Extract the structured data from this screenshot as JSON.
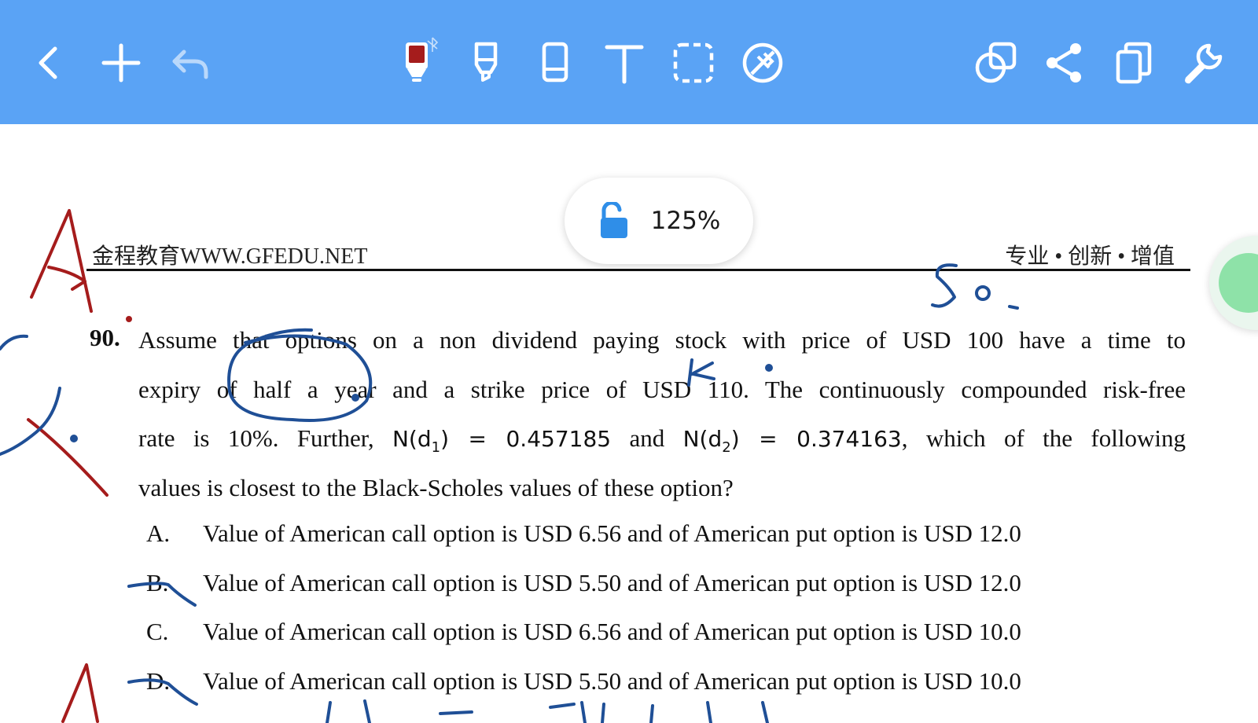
{
  "toolbar": {
    "left_icons": [
      "back-icon",
      "add-icon",
      "undo-icon"
    ],
    "center_icons": [
      "pen-icon",
      "highlighter-icon",
      "eraser-icon",
      "text-icon",
      "lasso-select-icon",
      "clear-icon"
    ],
    "right_icons": [
      "shapes-icon",
      "share-icon",
      "pages-icon",
      "settings-wrench-icon"
    ],
    "colors": {
      "bar": "#5aa3f5",
      "pen_ink": "#a51c1c",
      "icon": "#ffffff"
    }
  },
  "zoom": {
    "level": "125%",
    "lock_color": "#2f8ee8"
  },
  "document": {
    "header_left": "金程教育WWW.GFEDU.NET",
    "header_right": "专业 • 创新 • 增值",
    "question_number": "90.",
    "question_lines": [
      "Assume that options on a non dividend paying stock with price of USD 100 have a time to",
      "expiry of half a year and a strike price of USD 110. The continuously compounded risk-free",
      [
        "rate is 10%. Further, ",
        "N(d",
        "1",
        ") = 0.457185",
        " and ",
        "N(d",
        "2",
        ") = 0.374163",
        ", which of the following"
      ],
      "values is closest to the Black-Scholes values of these option?"
    ],
    "options": [
      {
        "letter": "A.",
        "text": "Value of American call option is USD 6.56 and of American put option is USD 12.0"
      },
      {
        "letter": "B.",
        "text": "Value of American call option is USD 5.50 and of American put option is USD 12.0"
      },
      {
        "letter": "C.",
        "text": "Value of American call option is USD 6.56 and of American put option is USD 10.0"
      },
      {
        "letter": "D.",
        "text": "Value of American call option is USD 5.50 and of American put option is USD 10.0"
      }
    ]
  },
  "annotations": {
    "ink_colors": {
      "red": "#a51c1c",
      "blue": "#1f4f96"
    },
    "handwritten": [
      "So.",
      "K."
    ]
  }
}
